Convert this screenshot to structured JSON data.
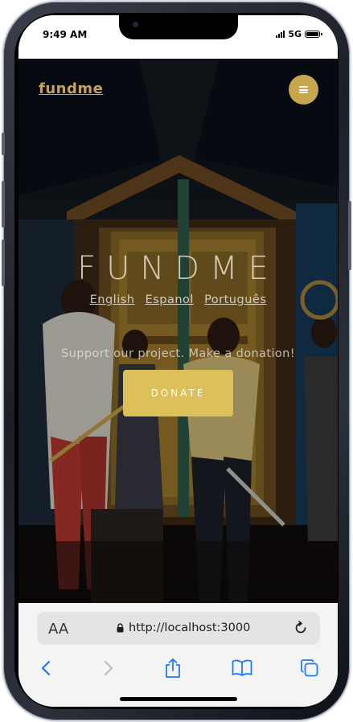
{
  "status_bar": {
    "time": "9:49 AM",
    "network": "5G"
  },
  "hero": {
    "brand": "fundme",
    "title": "FUNDME",
    "languages": [
      "English",
      "Espanol",
      "Português"
    ],
    "tagline": "Support our project. Make a donation!",
    "donate_label": "DONATE"
  },
  "browser": {
    "text_size_label": "AA",
    "url": "http://localhost:3000"
  },
  "colors": {
    "accent_gold": "#dcc15a",
    "brand_gold": "#c6a35a",
    "ios_blue": "#1a7cf5"
  },
  "icons": {
    "menu": "menu-icon",
    "lock": "lock-icon",
    "reload": "reload-icon",
    "back": "chevron-left-icon",
    "forward": "chevron-right-icon",
    "share": "share-icon",
    "bookmarks": "book-icon",
    "tabs": "tabs-icon"
  }
}
